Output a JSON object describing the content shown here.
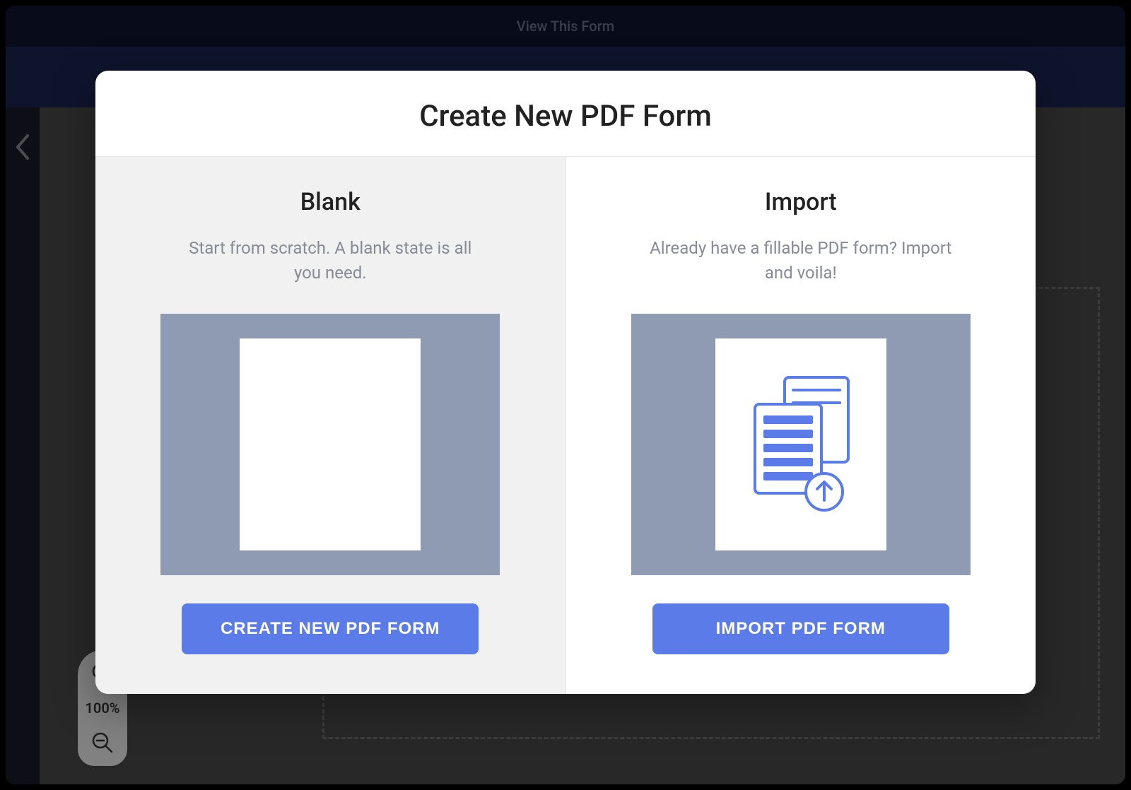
{
  "top_bar": {
    "label": "View This Form"
  },
  "zoom": {
    "level": "100%"
  },
  "modal": {
    "title": "Create New PDF Form",
    "options": {
      "blank": {
        "title": "Blank",
        "description": "Start from scratch. A blank state is all you need.",
        "button": "CREATE NEW PDF FORM"
      },
      "import": {
        "title": "Import",
        "description": "Already have a fillable PDF form? Import and voila!",
        "button": "IMPORT PDF FORM"
      }
    }
  },
  "icons": {
    "back_chevron": "chevron-left-icon",
    "zoom_in": "plus-magnifier-icon",
    "zoom_out": "minus-magnifier-icon",
    "blank_page": "blank-page-icon",
    "import_form": "upload-form-icon"
  }
}
